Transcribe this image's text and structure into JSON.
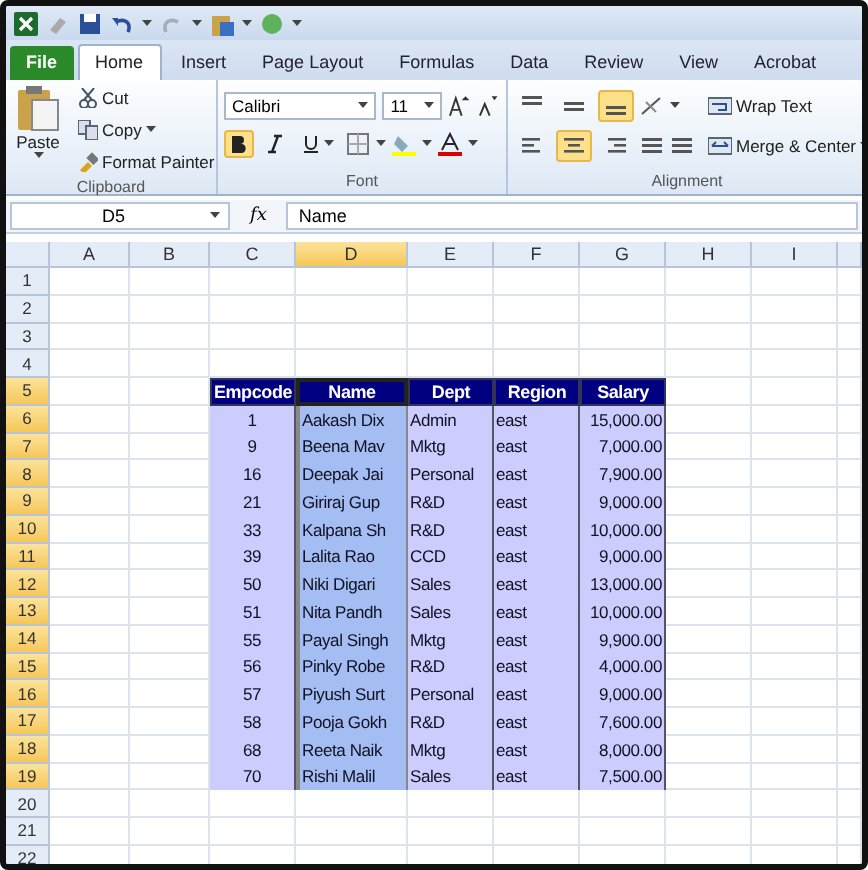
{
  "tabs": [
    {
      "label": "File",
      "kind": "file",
      "selected": false
    },
    {
      "label": "Home",
      "kind": "tab",
      "selected": true
    },
    {
      "label": "Insert",
      "kind": "tab",
      "selected": false
    },
    {
      "label": "Page Layout",
      "kind": "tab",
      "selected": false
    },
    {
      "label": "Formulas",
      "kind": "tab",
      "selected": false
    },
    {
      "label": "Data",
      "kind": "tab",
      "selected": false
    },
    {
      "label": "Review",
      "kind": "tab",
      "selected": false
    },
    {
      "label": "View",
      "kind": "tab",
      "selected": false
    },
    {
      "label": "Acrobat",
      "kind": "tab",
      "selected": false
    }
  ],
  "ribbon": {
    "clipboard": {
      "label": "Clipboard",
      "paste": "Paste",
      "cut": "Cut",
      "copy": "Copy",
      "format_painter": "Format Painter"
    },
    "font": {
      "label": "Font",
      "font_name": "Calibri",
      "font_size": "11",
      "bold": true,
      "italic": false,
      "underline": false
    },
    "alignment": {
      "label": "Alignment",
      "top": false,
      "middle": false,
      "bottom": true,
      "left": false,
      "center": true,
      "right": false,
      "wrap_text": "Wrap Text",
      "merge": "Merge & Center"
    }
  },
  "formula_bar": {
    "name_box": "D5",
    "function_label": "fx",
    "value": "Name"
  },
  "sheet": {
    "columns": [
      {
        "label": "A",
        "selected": false
      },
      {
        "label": "B",
        "selected": false
      },
      {
        "label": "C",
        "selected": false
      },
      {
        "label": "D",
        "selected": true
      },
      {
        "label": "E",
        "selected": false
      },
      {
        "label": "F",
        "selected": false
      },
      {
        "label": "G",
        "selected": false
      },
      {
        "label": "H",
        "selected": false
      },
      {
        "label": "I",
        "selected": false
      }
    ],
    "rows": [
      {
        "label": "1",
        "selected": false
      },
      {
        "label": "2",
        "selected": false
      },
      {
        "label": "3",
        "selected": false
      },
      {
        "label": "4",
        "selected": false
      },
      {
        "label": "5",
        "selected": true
      },
      {
        "label": "6",
        "selected": true
      },
      {
        "label": "7",
        "selected": true
      },
      {
        "label": "8",
        "selected": true
      },
      {
        "label": "9",
        "selected": true
      },
      {
        "label": "10",
        "selected": true
      },
      {
        "label": "11",
        "selected": true
      },
      {
        "label": "12",
        "selected": true
      },
      {
        "label": "13",
        "selected": true
      },
      {
        "label": "14",
        "selected": true
      },
      {
        "label": "15",
        "selected": true
      },
      {
        "label": "16",
        "selected": true
      },
      {
        "label": "17",
        "selected": true
      },
      {
        "label": "18",
        "selected": true
      },
      {
        "label": "19",
        "selected": true
      },
      {
        "label": "20",
        "selected": false
      },
      {
        "label": "21",
        "selected": false
      },
      {
        "label": "22",
        "selected": false
      }
    ]
  },
  "table": {
    "columns": [
      {
        "label": "Empcode",
        "kind": "center"
      },
      {
        "label": "Name",
        "kind": "text"
      },
      {
        "label": "Dept",
        "kind": "text"
      },
      {
        "label": "Region",
        "kind": "text"
      },
      {
        "label": "Salary",
        "kind": "number"
      }
    ],
    "rows": [
      [
        "1",
        "Aakash Dix",
        "Admin",
        "east",
        "15,000.00"
      ],
      [
        "9",
        "Beena Mav",
        "Mktg",
        "east",
        "7,000.00"
      ],
      [
        "16",
        "Deepak Jai",
        "Personal",
        "east",
        "7,900.00"
      ],
      [
        "21",
        "Giriraj Gup",
        "R&D",
        "east",
        "9,000.00"
      ],
      [
        "33",
        "Kalpana Sh",
        "R&D",
        "east",
        "10,000.00"
      ],
      [
        "39",
        "Lalita Rao",
        "CCD",
        "east",
        "9,000.00"
      ],
      [
        "50",
        "Niki Digari",
        "Sales",
        "east",
        "13,000.00"
      ],
      [
        "51",
        "Nita Pandh",
        "Sales",
        "east",
        "10,000.00"
      ],
      [
        "55",
        "Payal Singh",
        "Mktg",
        "east",
        "9,900.00"
      ],
      [
        "56",
        "Pinky Robe",
        "R&D",
        "east",
        "4,000.00"
      ],
      [
        "57",
        "Piyush Surt",
        "Personal",
        "east",
        "9,000.00"
      ],
      [
        "58",
        "Pooja Gokh",
        "R&D",
        "east",
        "7,600.00"
      ],
      [
        "68",
        "Reeta Naik",
        "Mktg",
        "east",
        "8,000.00"
      ],
      [
        "70",
        "Rishi Malil",
        "Sales",
        "east",
        "7,500.00"
      ]
    ]
  }
}
